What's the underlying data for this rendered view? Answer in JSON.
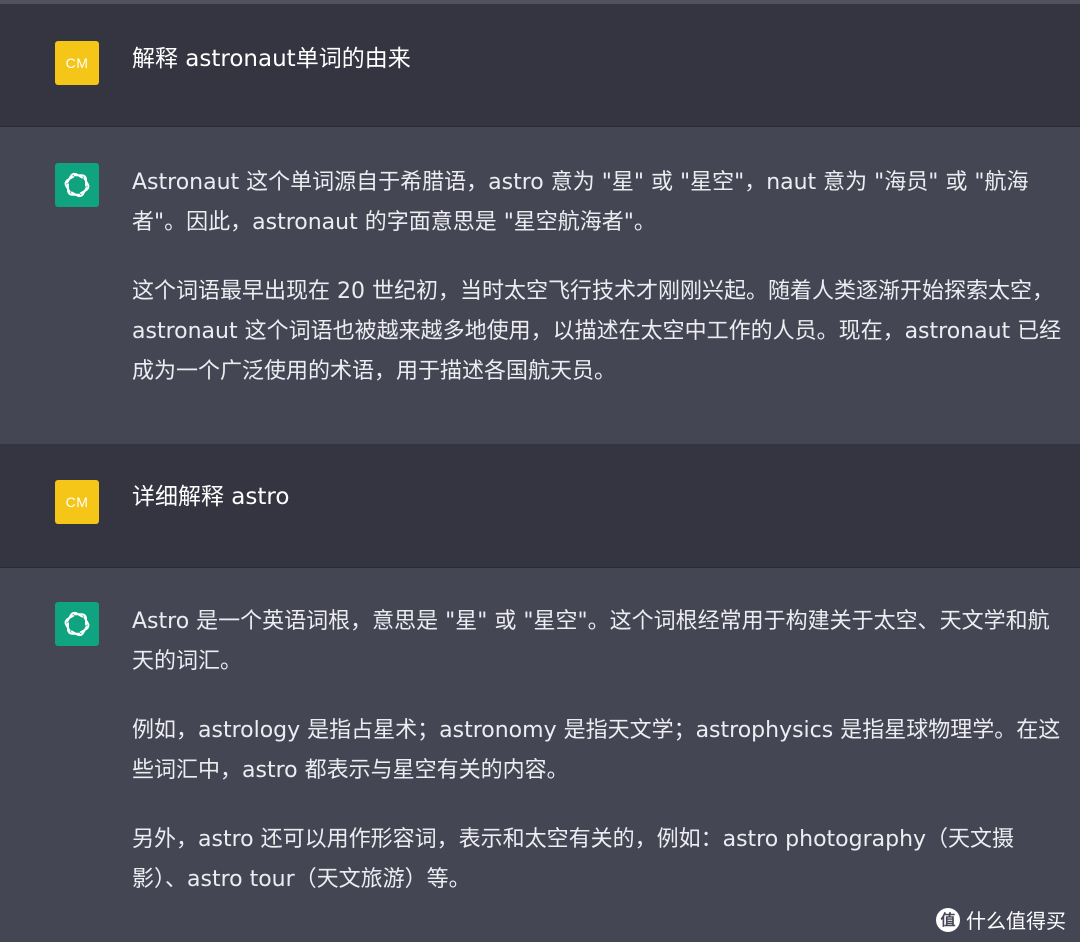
{
  "conversation": {
    "messages": [
      {
        "role": "user",
        "avatar_text": "CM",
        "paragraphs": [
          "解释  astronaut单词的由来"
        ]
      },
      {
        "role": "assistant",
        "avatar_icon": "openai-logo-icon",
        "paragraphs": [
          "Astronaut 这个单词源自于希腊语，astro 意为 \"星\" 或 \"星空\"，naut 意为 \"海员\" 或 \"航海者\"。因此，astronaut 的字面意思是 \"星空航海者\"。",
          "这个词语最早出现在 20 世纪初，当时太空飞行技术才刚刚兴起。随着人类逐渐开始探索太空，astronaut 这个词语也被越来越多地使用，以描述在太空中工作的人员。现在，astronaut 已经成为一个广泛使用的术语，用于描述各国航天员。"
        ]
      },
      {
        "role": "user",
        "avatar_text": "CM",
        "paragraphs": [
          "详细解释 astro"
        ]
      },
      {
        "role": "assistant",
        "avatar_icon": "openai-logo-icon",
        "paragraphs": [
          "Astro 是一个英语词根，意思是 \"星\" 或 \"星空\"。这个词根经常用于构建关于太空、天文学和航天的词汇。",
          "例如，astrology 是指占星术；astronomy 是指天文学；astrophysics 是指星球物理学。在这些词汇中，astro 都表示与星空有关的内容。",
          "另外，astro 还可以用作形容词，表示和太空有关的，例如：astro photography（天文摄影）、astro tour（天文旅游）等。"
        ]
      }
    ]
  },
  "watermark": {
    "badge": "值",
    "text": "什么值得买"
  },
  "colors": {
    "user_bg": "#343541",
    "assistant_bg": "#444654",
    "user_avatar": "#f5c518",
    "bot_avatar": "#10a37f"
  }
}
